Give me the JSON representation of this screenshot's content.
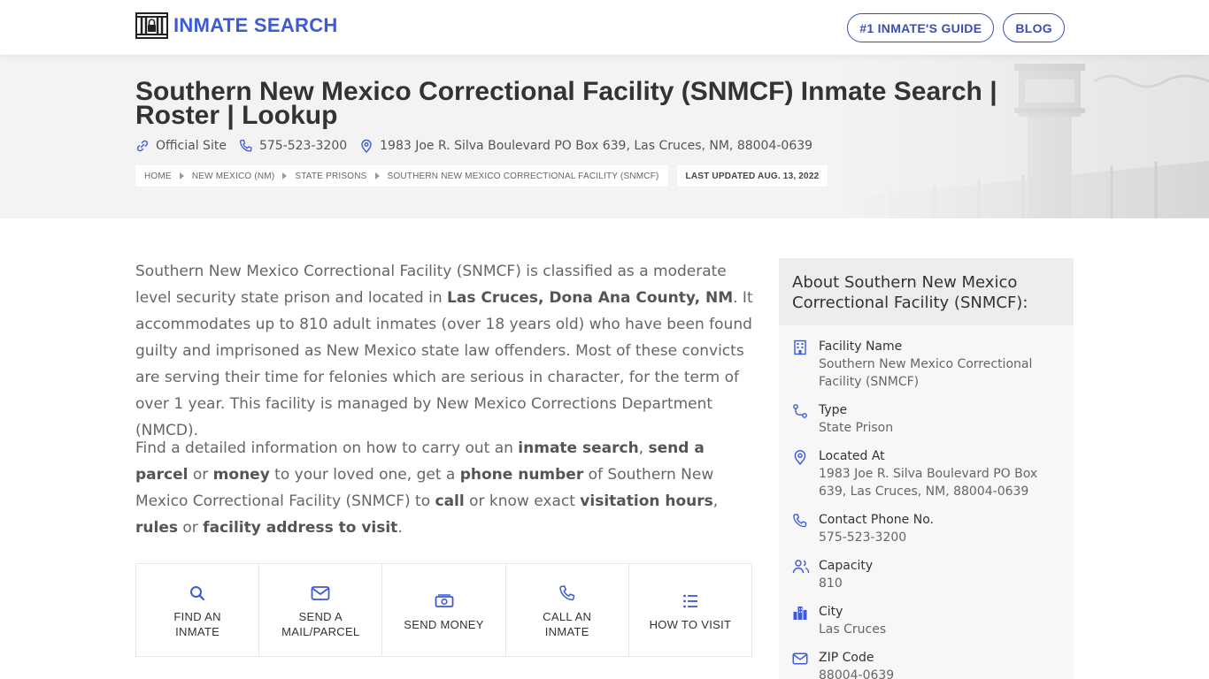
{
  "header": {
    "logo_text": "INMATE SEARCH",
    "nav": [
      "#1 INMATE'S GUIDE",
      "BLOG"
    ]
  },
  "hero": {
    "title": "Southern New Mexico Correctional Facility (SNMCF) Inmate Search | Roster | Lookup",
    "official_site": "Official Site",
    "phone": "575-523-3200",
    "address": "1983 Joe R. Silva Boulevard PO Box 639, Las Cruces, NM, 88004-0639",
    "breadcrumbs": [
      "HOME",
      "NEW MEXICO (NM)",
      "STATE PRISONS",
      "SOUTHERN NEW MEXICO CORRECTIONAL FACILITY (SNMCF)"
    ],
    "last_updated": "LAST UPDATED AUG. 13, 2022"
  },
  "content": {
    "p1": [
      {
        "t": "Southern New Mexico Correctional Facility (SNMCF) is classified as a moderate level security state prison and located in "
      },
      {
        "t": "Las Cruces, Dona Ana County, NM",
        "b": true
      },
      {
        "t": ". It accommodates up to 810 adult inmates (over 18 years old) who have been found guilty and imprisoned as New Mexico state law offenders. Most of these convicts are serving their time for felonies which are serious in character, for the term of over 1 year. This facility is managed by New Mexico Corrections Department (NMCD)."
      }
    ],
    "p2": [
      {
        "t": "Find a detailed information on how to carry out an "
      },
      {
        "t": "inmate search",
        "b": true
      },
      {
        "t": ", "
      },
      {
        "t": "send a parcel",
        "b": true
      },
      {
        "t": " or "
      },
      {
        "t": "money",
        "b": true
      },
      {
        "t": " to your loved one, get a "
      },
      {
        "t": "phone number",
        "b": true
      },
      {
        "t": " of Southern New Mexico Correctional Facility (SNMCF) to "
      },
      {
        "t": "call",
        "b": true
      },
      {
        "t": " or know exact "
      },
      {
        "t": "visitation hours",
        "b": true
      },
      {
        "t": ", "
      },
      {
        "t": "rules",
        "b": true
      },
      {
        "t": " or "
      },
      {
        "t": "facility address to visit",
        "b": true
      },
      {
        "t": "."
      }
    ]
  },
  "actions": [
    {
      "label": "FIND AN INMATE",
      "icon": "search-icon"
    },
    {
      "label": "SEND A MAIL/PARCEL",
      "icon": "mail-icon"
    },
    {
      "label": "SEND MONEY",
      "icon": "money-icon"
    },
    {
      "label": "CALL AN INMATE",
      "icon": "phone-icon"
    },
    {
      "label": "HOW TO VISIT",
      "icon": "list-icon"
    }
  ],
  "sidebar": {
    "title": "About Southern New Mexico Correctional Facility (SNMCF):",
    "items": [
      {
        "label": "Facility Name",
        "value": "Southern New Mexico Correctional Facility (SNMCF)",
        "icon": "building-icon"
      },
      {
        "label": "Type",
        "value": "State Prison",
        "icon": "route-icon"
      },
      {
        "label": "Located At",
        "value": "1983 Joe R. Silva Boulevard PO Box 639, Las Cruces, NM, 88004-0639",
        "icon": "location-pin-icon"
      },
      {
        "label": "Contact Phone No.",
        "value": "575-523-3200",
        "icon": "phone-icon"
      },
      {
        "label": "Capacity",
        "value": "810",
        "icon": "users-icon"
      },
      {
        "label": "City",
        "value": "Las Cruces",
        "icon": "city-icon"
      },
      {
        "label": "ZIP Code",
        "value": "88004-0639",
        "icon": "mail-icon"
      }
    ]
  },
  "colors": {
    "brand": "#3d5ad8",
    "nav_border": "#3d4fa8",
    "hero_bg": "#f3f3f4",
    "sidebar_bg": "#f7f7f7"
  }
}
